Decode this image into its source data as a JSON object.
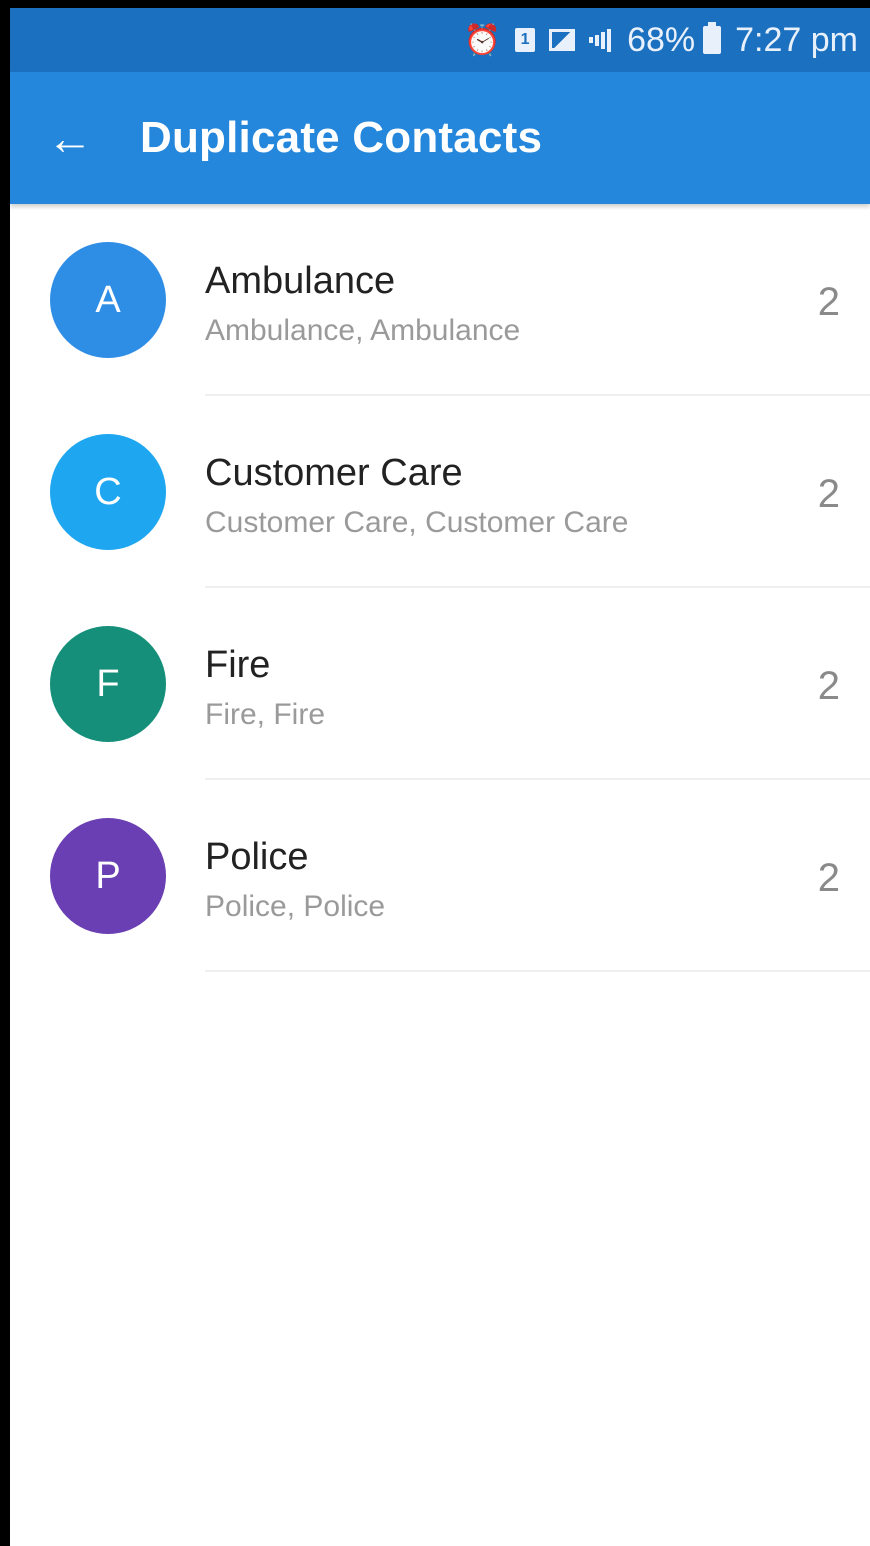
{
  "status_bar": {
    "alarm_icon": "alarm-clock-icon",
    "sim_label": "1",
    "battery_percent": "68%",
    "time": "7:27 pm"
  },
  "app_bar": {
    "back_icon": "arrow-left-icon",
    "title": "Duplicate Contacts",
    "color": "#2587dc"
  },
  "contacts": [
    {
      "initial": "A",
      "name": "Ambulance",
      "duplicates": "Ambulance, Ambulance",
      "count": "2",
      "color": "#2e8ee6"
    },
    {
      "initial": "C",
      "name": "Customer Care",
      "duplicates": "Customer Care, Customer Care",
      "count": "2",
      "color": "#1ea7f0"
    },
    {
      "initial": "F",
      "name": "Fire",
      "duplicates": "Fire, Fire",
      "count": "2",
      "color": "#158f7a"
    },
    {
      "initial": "P",
      "name": "Police",
      "duplicates": "Police, Police",
      "count": "2",
      "color": "#6a3fb3"
    }
  ]
}
